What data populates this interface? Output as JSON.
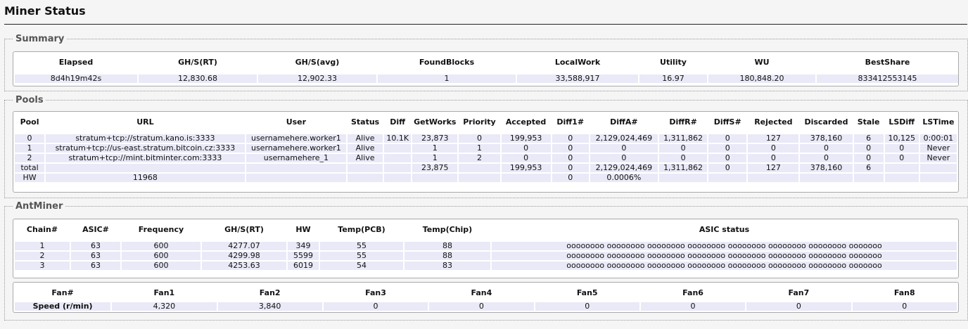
{
  "page": {
    "title": "Miner Status"
  },
  "summary": {
    "legend": "Summary",
    "headers": [
      "Elapsed",
      "GH/S(RT)",
      "GH/S(avg)",
      "FoundBlocks",
      "LocalWork",
      "Utility",
      "WU",
      "BestShare"
    ],
    "row": [
      "8d4h19m42s",
      "12,830.68",
      "12,902.33",
      "1",
      "33,588,917",
      "16.97",
      "180,848.20",
      "833412553145"
    ]
  },
  "pools": {
    "legend": "Pools",
    "headers": [
      "Pool",
      "URL",
      "User",
      "Status",
      "Diff",
      "GetWorks",
      "Priority",
      "Accepted",
      "Diff1#",
      "DiffA#",
      "DiffR#",
      "DiffS#",
      "Rejected",
      "Discarded",
      "Stale",
      "LSDiff",
      "LSTime"
    ],
    "rows": [
      [
        "0",
        "stratum+tcp://stratum.kano.is:3333",
        "usernamehere.worker1",
        "Alive",
        "10.1K",
        "23,873",
        "0",
        "199,953",
        "0",
        "2,129,024,469",
        "1,311,862",
        "0",
        "127",
        "378,160",
        "6",
        "10,125",
        "0:00:01"
      ],
      [
        "1",
        "stratum+tcp://us-east.stratum.bitcoin.cz:3333",
        "usernamehere.worker1",
        "Alive",
        "",
        "1",
        "1",
        "0",
        "0",
        "0",
        "0",
        "0",
        "0",
        "0",
        "0",
        "0",
        "Never"
      ],
      [
        "2",
        "stratum+tcp://mint.bitminter.com:3333",
        "usernamehere_1",
        "Alive",
        "",
        "1",
        "2",
        "0",
        "0",
        "0",
        "0",
        "0",
        "0",
        "0",
        "0",
        "0",
        "Never"
      ]
    ],
    "total_row": [
      "total",
      "",
      "",
      "",
      "",
      "23,875",
      "",
      "199,953",
      "0",
      "2,129,024,469",
      "1,311,862",
      "0",
      "127",
      "378,160",
      "6",
      "",
      ""
    ],
    "hw_row": {
      "label": "HW",
      "url": "11968",
      "diff1": "0",
      "diffa": "0.0006%"
    }
  },
  "antminer": {
    "legend": "AntMiner",
    "headers": [
      "Chain#",
      "ASIC#",
      "Frequency",
      "GH/S(RT)",
      "HW",
      "Temp(PCB)",
      "Temp(Chip)",
      "ASIC status"
    ],
    "rows": [
      [
        "1",
        "63",
        "600",
        "4277.07",
        "349",
        "55",
        "88",
        "oooooooo oooooooo oooooooo oooooooo oooooooo oooooooo oooooooo ooooooo"
      ],
      [
        "2",
        "63",
        "600",
        "4299.98",
        "5599",
        "55",
        "88",
        "oooooooo oooooooo oooooooo oooooooo oooooooo oooooooo oooooooo ooooooo"
      ],
      [
        "3",
        "63",
        "600",
        "4253.63",
        "6019",
        "54",
        "83",
        "oooooooo oooooooo oooooooo oooooooo oooooooo oooooooo oooooooo ooooooo"
      ]
    ],
    "fans": {
      "headers": [
        "Fan#",
        "Fan1",
        "Fan2",
        "Fan3",
        "Fan4",
        "Fan5",
        "Fan6",
        "Fan7",
        "Fan8"
      ],
      "row": [
        "Speed (r/min)",
        "4,320",
        "3,840",
        "0",
        "0",
        "0",
        "0",
        "0",
        "0"
      ]
    }
  }
}
